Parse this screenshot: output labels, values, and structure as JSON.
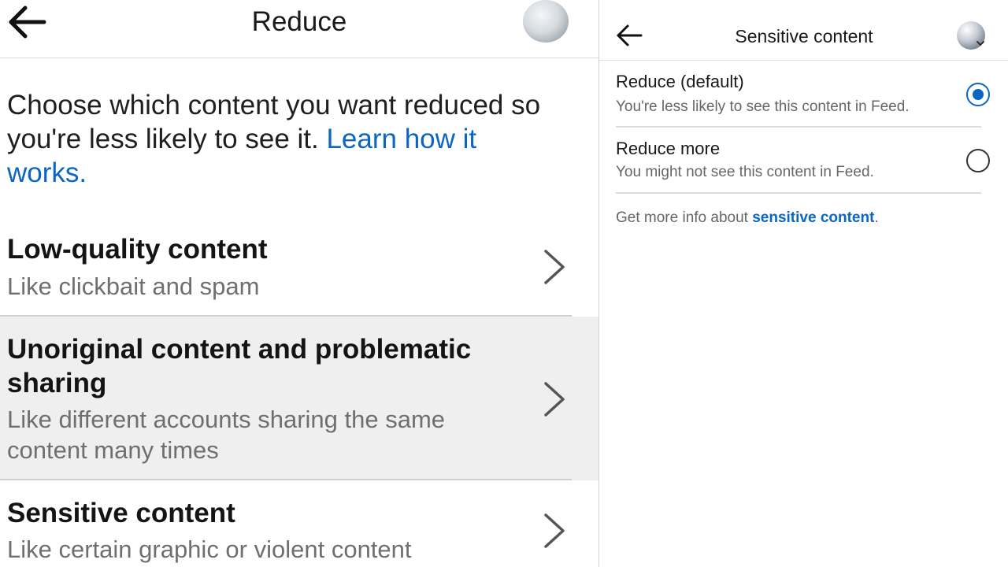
{
  "left": {
    "header": {
      "title": "Reduce"
    },
    "intro": {
      "text": "Choose which content you want reduced so you're less likely to see it. ",
      "link": "Learn how it works."
    },
    "rows": [
      {
        "title": "Low-quality content",
        "subtitle": "Like clickbait and spam"
      },
      {
        "title": "Unoriginal content and problematic sharing",
        "subtitle": "Like different accounts sharing the same content many times"
      },
      {
        "title": "Sensitive content",
        "subtitle": "Like certain graphic or violent content"
      }
    ]
  },
  "right": {
    "header": {
      "title": "Sensitive content"
    },
    "options": [
      {
        "title": "Reduce (default)",
        "subtitle": "You're less likely to see this content in Feed.",
        "selected": true
      },
      {
        "title": "Reduce more",
        "subtitle": "You might not see this content in Feed.",
        "selected": false
      }
    ],
    "more_info": {
      "prefix": "Get more info about ",
      "link": "sensitive content",
      "suffix": "."
    }
  },
  "colors": {
    "link": "#0a66c2",
    "selected_row_bg": "#efefef"
  },
  "icons": {
    "back": "arrow-left-icon",
    "chevron": "chevron-right-icon",
    "radio": "radio-button-icon"
  }
}
